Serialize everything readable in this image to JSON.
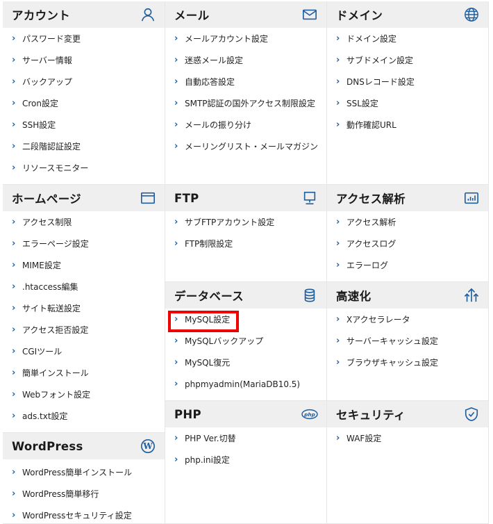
{
  "colors": {
    "accent": "#1f5f9f",
    "header_bg": "#efefef",
    "highlight": "#ee0000"
  },
  "panels": {
    "account": {
      "title": "アカウント",
      "icon": "user-icon",
      "items": [
        "パスワード変更",
        "サーバー情報",
        "バックアップ",
        "Cron設定",
        "SSH設定",
        "二段階認証設定",
        "リソースモニター"
      ]
    },
    "mail": {
      "title": "メール",
      "icon": "envelope-icon",
      "items": [
        "メールアカウント設定",
        "迷惑メール設定",
        "自動応答設定",
        "SMTP認証の国外アクセス制限設定",
        "メールの振り分け",
        "メーリングリスト・メールマガジン"
      ]
    },
    "domain": {
      "title": "ドメイン",
      "icon": "globe-icon",
      "items": [
        "ドメイン設定",
        "サブドメイン設定",
        "DNSレコード設定",
        "SSL設定",
        "動作確認URL"
      ]
    },
    "homepage": {
      "title": "ホームページ",
      "icon": "browser-window-icon",
      "items": [
        "アクセス制限",
        "エラーページ設定",
        "MIME設定",
        ".htaccess編集",
        "サイト転送設定",
        "アクセス拒否設定",
        "CGIツール",
        "簡単インストール",
        "Webフォント設定",
        "ads.txt設定"
      ]
    },
    "ftp": {
      "title": "FTP",
      "icon": "monitor-icon",
      "items": [
        "サブFTPアカウント設定",
        "FTP制限設定"
      ]
    },
    "analytics": {
      "title": "アクセス解析",
      "icon": "bar-chart-icon",
      "items": [
        "アクセス解析",
        "アクセスログ",
        "エラーログ"
      ]
    },
    "database": {
      "title": "データベース",
      "icon": "database-icon",
      "items": [
        "MySQL設定",
        "MySQLバックアップ",
        "MySQL復元",
        "phpmyadmin(MariaDB10.5)"
      ]
    },
    "speed": {
      "title": "高速化",
      "icon": "speed-arrows-icon",
      "items": [
        "Xアクセラレータ",
        "サーバーキャッシュ設定",
        "ブラウザキャッシュ設定"
      ]
    },
    "wordpress": {
      "title": "WordPress",
      "icon": "wordpress-icon",
      "items": [
        "WordPress簡単インストール",
        "WordPress簡単移行",
        "WordPressセキュリティ設定"
      ]
    },
    "php": {
      "title": "PHP",
      "icon": "php-icon",
      "items": [
        "PHP Ver.切替",
        "php.ini設定"
      ]
    },
    "security": {
      "title": "セキュリティ",
      "icon": "shield-icon",
      "items": [
        "WAF設定"
      ]
    }
  }
}
